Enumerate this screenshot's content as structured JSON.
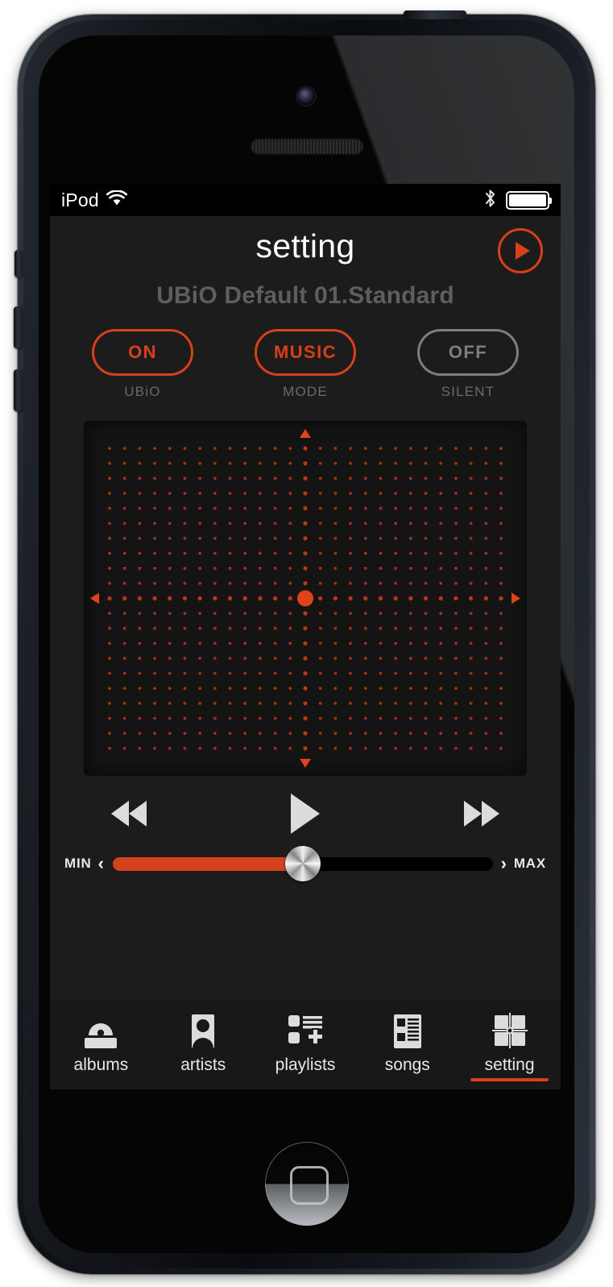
{
  "device": {
    "name": "iphone-5-black"
  },
  "status_bar": {
    "carrier": "iPod",
    "wifi_icon": "wifi-icon",
    "bluetooth_icon": "bluetooth-icon",
    "battery_icon": "battery-full-icon"
  },
  "header": {
    "title": "setting",
    "play_button_icon": "play-circle-icon"
  },
  "preset": {
    "name": "UBiO Default 01.Standard"
  },
  "toggles": [
    {
      "value": "ON",
      "label": "UBiO",
      "state": "on",
      "color": "#d9401a"
    },
    {
      "value": "MUSIC",
      "label": "MODE",
      "state": "on",
      "color": "#d9401a"
    },
    {
      "value": "OFF",
      "label": "SILENT",
      "state": "off",
      "color": "#7e7e7e"
    }
  ],
  "xy_pad": {
    "name": "eq-xy-pad",
    "dot_color": "#c43a12",
    "center_dot_color": "#e0431a",
    "grid_columns": 27,
    "grid_rows": 21,
    "center_x_index": 13,
    "center_y_index": 10,
    "arrow_up": "triangle-up-marker",
    "arrow_down": "triangle-down-marker",
    "arrow_left": "triangle-left-marker",
    "arrow_right": "triangle-right-marker"
  },
  "transport": {
    "rewind": "rewind-icon",
    "play": "play-icon",
    "forward": "fast-forward-icon"
  },
  "volume": {
    "min_label": "MIN",
    "min_chevron": "‹",
    "max_label": "MAX",
    "max_chevron": "›",
    "percent": 50,
    "fill_color": "#d3421c"
  },
  "tabs": [
    {
      "label": "albums",
      "icon": "albums-icon",
      "active": false
    },
    {
      "label": "artists",
      "icon": "artists-icon",
      "active": false
    },
    {
      "label": "playlists",
      "icon": "playlists-icon",
      "active": false
    },
    {
      "label": "songs",
      "icon": "songs-icon",
      "active": false
    },
    {
      "label": "setting",
      "icon": "setting-icon",
      "active": true
    }
  ],
  "colors": {
    "accent": "#d9401a",
    "screen_bg": "#1c1c1c",
    "tabbar_bg": "#181818"
  }
}
